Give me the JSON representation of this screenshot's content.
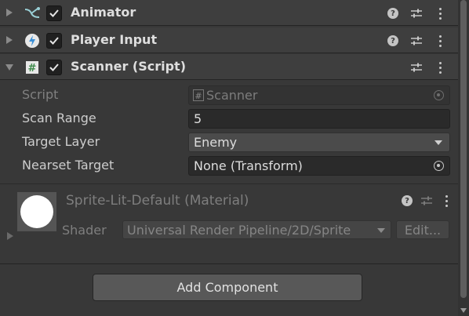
{
  "components": [
    {
      "title": "Animator",
      "icon": "animator-icon",
      "enabled": true,
      "expanded": false,
      "has_help": true
    },
    {
      "title": "Player Input",
      "icon": "player-input-icon",
      "enabled": true,
      "expanded": false,
      "has_help": true
    },
    {
      "title": "Scanner (Script)",
      "icon": "script-icon",
      "enabled": true,
      "expanded": true,
      "has_help": false
    }
  ],
  "scanner": {
    "script_label": "Script",
    "script_value": "Scanner",
    "scan_range_label": "Scan Range",
    "scan_range_value": "5",
    "target_layer_label": "Target Layer",
    "target_layer_value": "Enemy",
    "nearest_target_label": "Nearset Target",
    "nearest_target_value": "None (Transform)"
  },
  "material": {
    "title": "Sprite-Lit-Default (Material)",
    "shader_label": "Shader",
    "shader_value": "Universal Render Pipeline/2D/Sprite",
    "edit_label": "Edit..."
  },
  "add_component_label": "Add Component",
  "colors": {
    "background": "#383838",
    "header": "#3e3e3e",
    "field": "#2a2a2a",
    "text": "#dedede",
    "dim_text": "#7c7c7c"
  }
}
